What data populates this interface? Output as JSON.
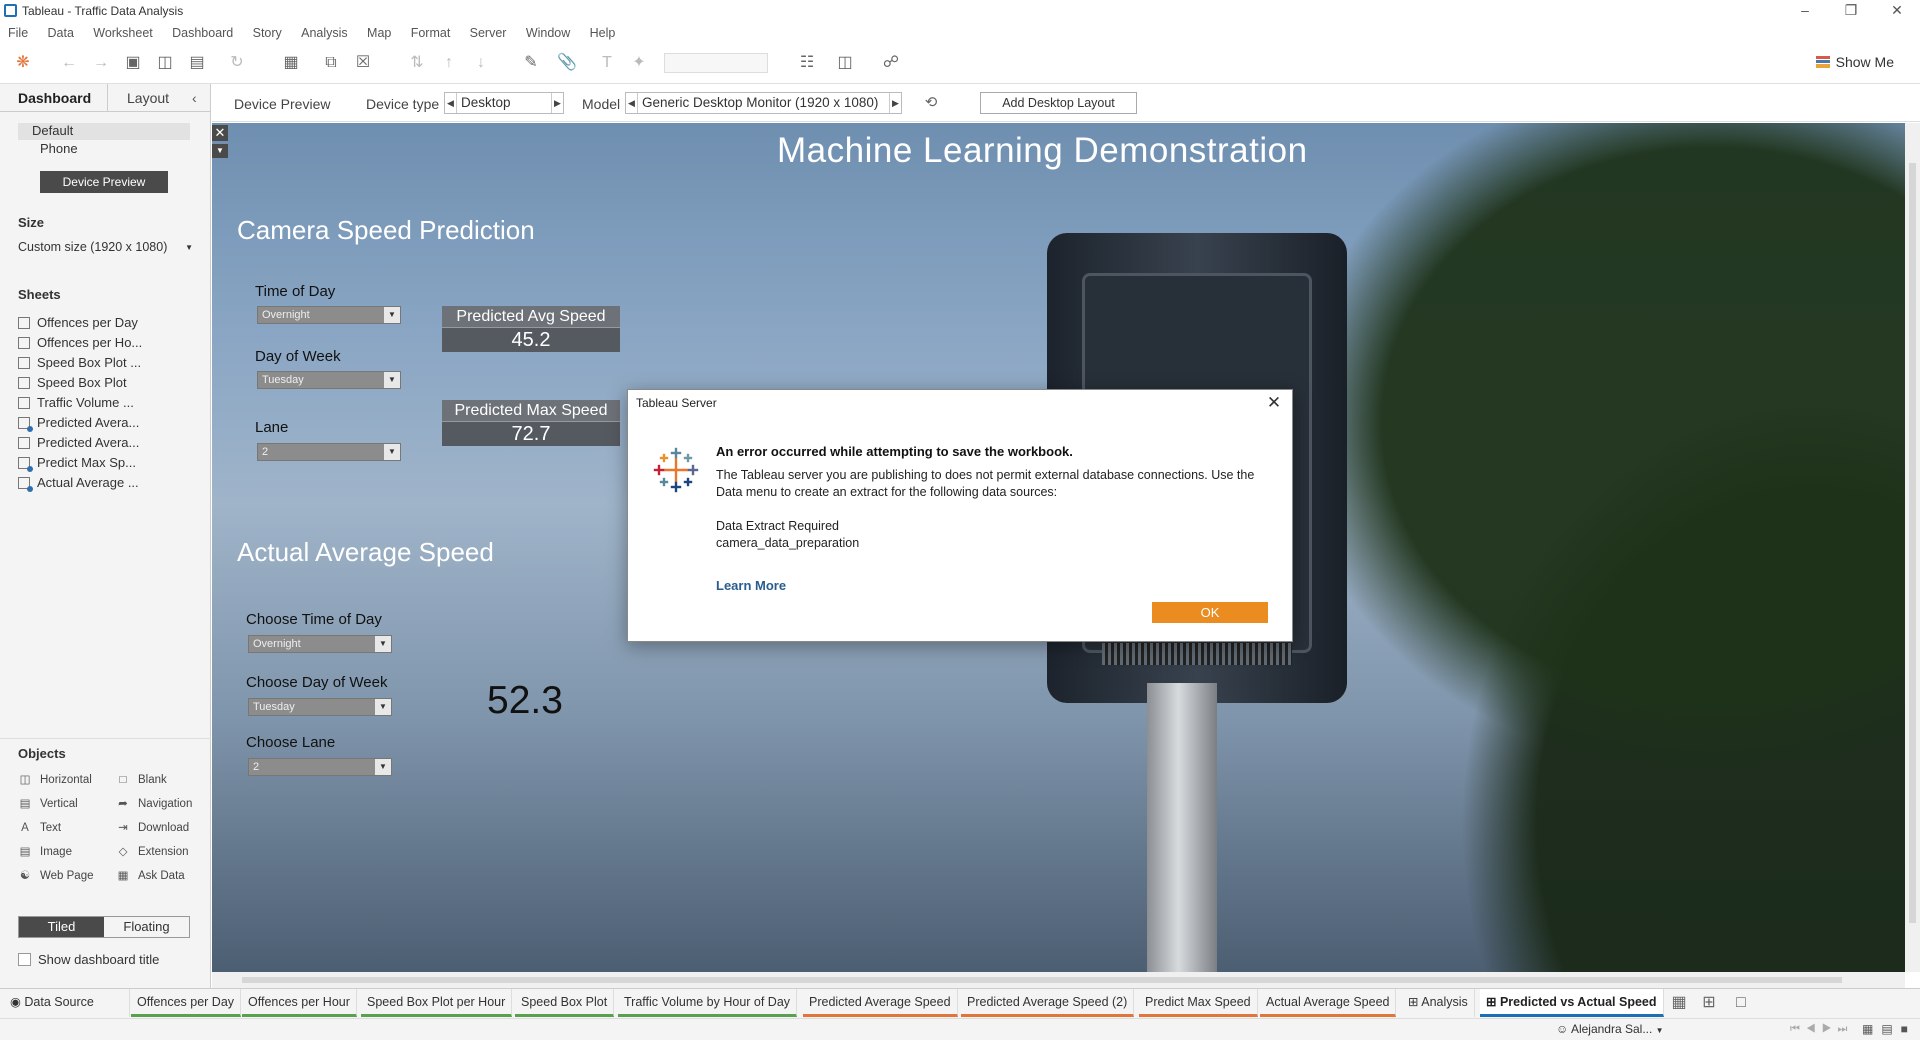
{
  "window": {
    "title": "Tableau - Traffic Data Analysis"
  },
  "menu": [
    "File",
    "Data",
    "Worksheet",
    "Dashboard",
    "Story",
    "Analysis",
    "Map",
    "Format",
    "Server",
    "Window",
    "Help"
  ],
  "toolbar": {
    "show_me": "Show Me"
  },
  "left_pane": {
    "tabs": {
      "dashboard": "Dashboard",
      "layout": "Layout",
      "collapse": "‹"
    },
    "layouts": [
      "Default",
      "Phone"
    ],
    "device_preview_button": "Device Preview",
    "size_heading": "Size",
    "size_value": "Custom size (1920 x 1080)",
    "sheets_heading": "Sheets",
    "sheets": [
      "Offences per Day",
      "Offences per Ho...",
      "Speed Box Plot ...",
      "Speed Box Plot",
      "Traffic Volume ...",
      "Predicted Avera...",
      "Predicted Avera...",
      "Predict Max Sp...",
      "Actual Average ..."
    ],
    "objects_heading": "Objects",
    "objects": [
      {
        "label": "Horizontal",
        "icon": "horizontal-icon"
      },
      {
        "label": "Blank",
        "icon": "blank-icon"
      },
      {
        "label": "Vertical",
        "icon": "vertical-icon"
      },
      {
        "label": "Navigation",
        "icon": "navigation-icon"
      },
      {
        "label": "Text",
        "icon": "text-icon"
      },
      {
        "label": "Download",
        "icon": "download-icon"
      },
      {
        "label": "Image",
        "icon": "image-icon"
      },
      {
        "label": "Extension",
        "icon": "extension-icon"
      },
      {
        "label": "Web Page",
        "icon": "web-page-icon"
      },
      {
        "label": "Ask Data",
        "icon": "ask-data-icon"
      }
    ],
    "tiled": "Tiled",
    "floating": "Floating",
    "show_title": "Show dashboard title"
  },
  "device_bar": {
    "device_preview": "Device Preview",
    "device_type_label": "Device type",
    "device_type_value": "Desktop",
    "model_label": "Model",
    "model_value": "Generic Desktop Monitor (1920 x 1080)",
    "add_layout": "Add Desktop Layout"
  },
  "dashboard": {
    "title": "Machine Learning Demonstration",
    "prediction": {
      "title": "Camera Speed Prediction",
      "time_label": "Time of Day",
      "time_value": "Overnight",
      "day_label": "Day of Week",
      "day_value": "Tuesday",
      "lane_label": "Lane",
      "lane_value": "2",
      "avg_kpi_label": "Predicted Avg Speed",
      "avg_kpi_value": "45.2",
      "max_kpi_label": "Predicted Max Speed",
      "max_kpi_value": "72.7"
    },
    "actual": {
      "title": "Actual Average Speed",
      "time_label": "Choose Time of Day",
      "time_value": "Overnight",
      "day_label": "Choose Day of Week",
      "day_value": "Tuesday",
      "lane_label": "Choose Lane",
      "lane_value": "2",
      "value": "52.3"
    }
  },
  "dialog": {
    "title": "Tableau Server",
    "heading": "An error occurred while attempting to save the workbook.",
    "body": "The Tableau server you are publishing to does not permit external database connections. Use the Data menu to create an extract for the following data sources:",
    "source_line1": "Data Extract Required",
    "source_line2": "camera_data_preparation",
    "learn_more": "Learn More",
    "ok": "OK"
  },
  "sheet_tabs": [
    {
      "label": "Data Source",
      "style": "plain"
    },
    {
      "label": "Offences per Day",
      "style": "green"
    },
    {
      "label": "Offences per Hour",
      "style": "green"
    },
    {
      "label": "Speed Box Plot per Hour",
      "style": "green"
    },
    {
      "label": "Speed Box Plot",
      "style": "green"
    },
    {
      "label": "Traffic Volume by Hour of Day",
      "style": "green"
    },
    {
      "label": "Predicted Average Speed",
      "style": "orange"
    },
    {
      "label": "Predicted Average Speed (2)",
      "style": "orange"
    },
    {
      "label": "Predict Max Speed",
      "style": "orange"
    },
    {
      "label": "Actual Average Speed",
      "style": "orange"
    },
    {
      "label": "Analysis",
      "style": "plain"
    },
    {
      "label": "Predicted vs Actual Speed",
      "style": "active"
    }
  ],
  "status": {
    "user": "Alejandra Sal..."
  },
  "colors": {
    "ok_button": "#eb8c21",
    "active_tab": "#1f6fb5",
    "link": "#2a5d8e"
  }
}
